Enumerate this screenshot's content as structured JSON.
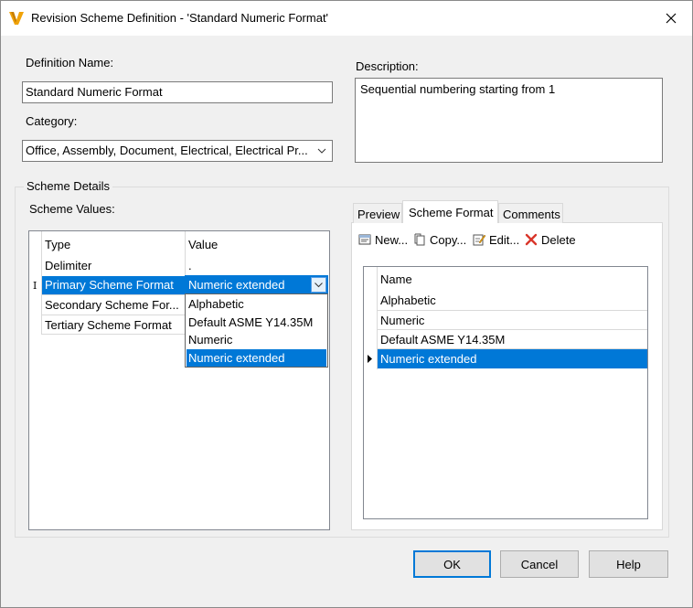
{
  "window": {
    "title": "Revision Scheme Definition - 'Standard Numeric Format'"
  },
  "form": {
    "definition_name_label": "Definition Name:",
    "definition_name_value": "Standard Numeric Format",
    "category_label": "Category:",
    "category_value": "Office, Assembly, Document, Electrical, Electrical Pr...",
    "description_label": "Description:",
    "description_value": "Sequential numbering starting from 1"
  },
  "scheme_details": {
    "group_label": "Scheme Details",
    "values_label": "Scheme Values:",
    "columns": [
      "Type",
      "Value"
    ],
    "rows": [
      {
        "type": "Delimiter",
        "value": "."
      },
      {
        "type": "Primary Scheme Format",
        "value": "Numeric extended"
      },
      {
        "type": "Secondary Scheme For...",
        "value": ""
      },
      {
        "type": "Tertiary Scheme Format",
        "value": ""
      }
    ],
    "row_marker": "I",
    "dropdown_options": [
      "Alphabetic",
      "Default ASME Y14.35M",
      "Numeric",
      "Numeric extended"
    ],
    "dropdown_selected": "Numeric extended"
  },
  "tabs": {
    "items": [
      "Preview",
      "Scheme Format",
      "Comments"
    ],
    "active": "Scheme Format"
  },
  "toolbar": {
    "new_label": "New...",
    "copy_label": "Copy...",
    "edit_label": "Edit...",
    "delete_label": "Delete"
  },
  "format_list": {
    "header": "Name",
    "items": [
      "Alphabetic",
      "Numeric",
      "Default ASME Y14.35M",
      "Numeric extended"
    ],
    "selected": "Numeric extended"
  },
  "buttons": {
    "ok": "OK",
    "cancel": "Cancel",
    "help": "Help"
  },
  "colors": {
    "selection": "#0078d7",
    "app_icon": "#f0a30a"
  }
}
